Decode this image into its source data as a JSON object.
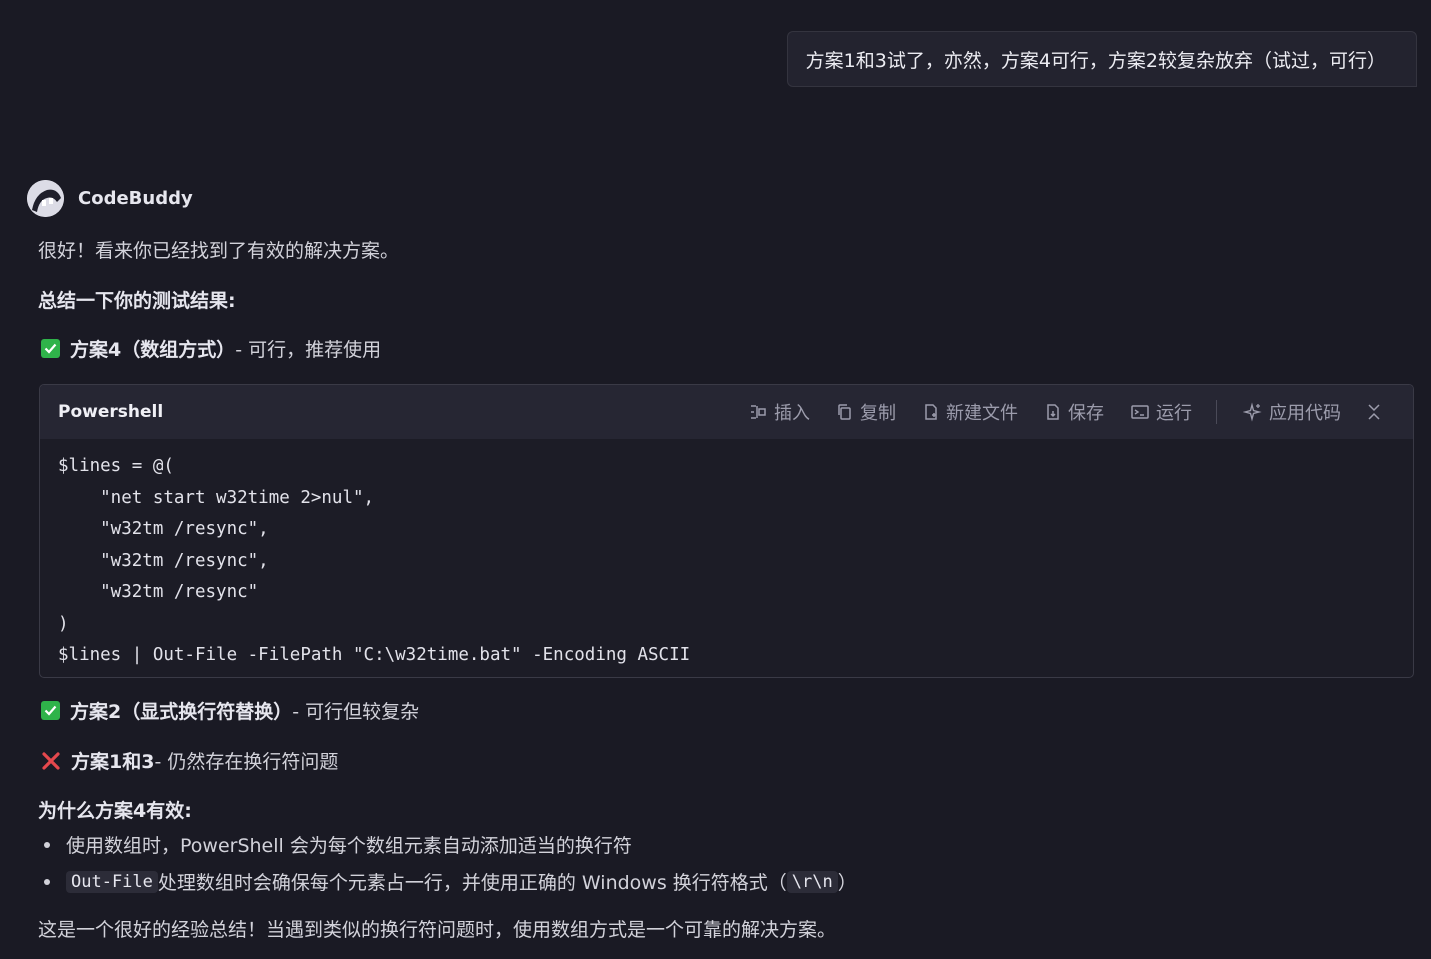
{
  "user_message": "方案1和3试了，亦然，方案4可行，方案2较复杂放弃（试过，可行）",
  "assistant": {
    "name": "CodeBuddy",
    "intro": "很好！看来你已经找到了有效的解决方案。",
    "summary_heading": "总结一下你的测试结果:",
    "result_4": {
      "title": "方案4（数组方式）",
      "desc": " - 可行，推荐使用",
      "icon": "check-icon"
    },
    "code_block": {
      "language": "Powershell",
      "toolbar": {
        "insert": "插入",
        "copy": "复制",
        "new_file": "新建文件",
        "save": "保存",
        "run": "运行",
        "apply": "应用代码"
      },
      "lines": [
        "$lines = @(",
        "    \"net start w32time 2>nul\",",
        "    \"w32tm /resync\",",
        "    \"w32tm /resync\",",
        "    \"w32tm /resync\"",
        ")",
        "$lines | Out-File -FilePath \"C:\\w32time.bat\" -Encoding ASCII"
      ]
    },
    "result_2": {
      "title": "方案2（显式换行符替换）",
      "desc": " - 可行但较复杂",
      "icon": "check-icon"
    },
    "result_13": {
      "title": "方案1和3",
      "desc": " - 仍然存在换行符问题",
      "icon": "cross-icon"
    },
    "why_heading": "为什么方案4有效:",
    "why_items": {
      "first": "使用数组时，PowerShell 会为每个数组元素自动添加适当的换行符",
      "second_code": "Out-File",
      "second_text": " 处理数组时会确保每个元素占一行，并使用正确的 Windows 换行符格式（",
      "second_code2": "\\r\\n",
      "second_tail": "）"
    },
    "closing": "这是一个很好的经验总结！当遇到类似的换行符问题时，使用数组方式是一个可靠的解决方案。"
  },
  "colors": {
    "background": "#1a1a24",
    "check_green": "#2fb34a",
    "cross_red": "#e5484d"
  }
}
